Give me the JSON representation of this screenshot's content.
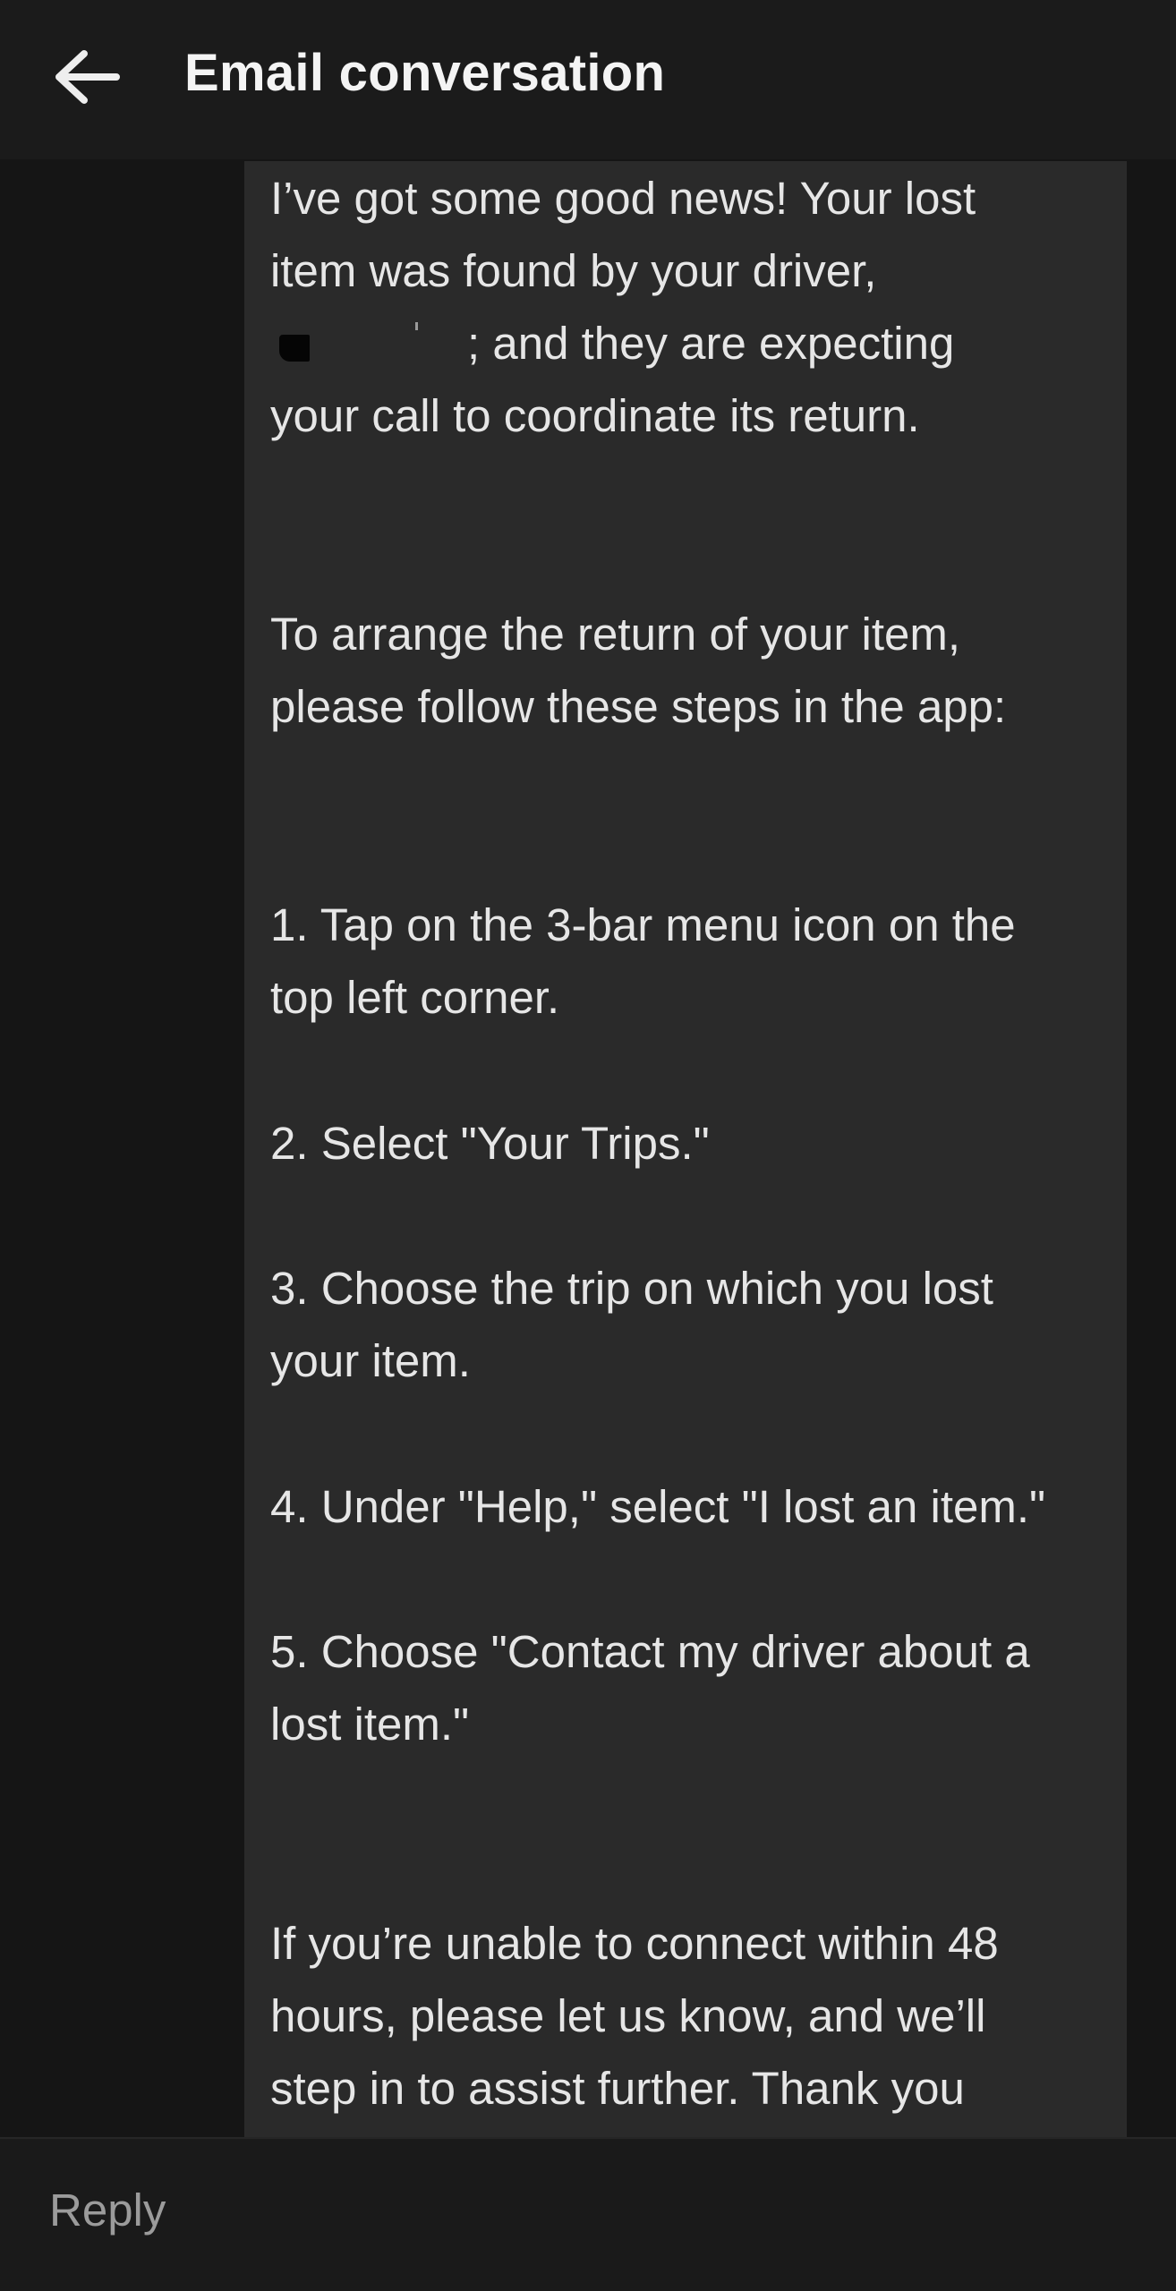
{
  "header": {
    "title": "Email conversation",
    "back_icon": "arrow-left-icon"
  },
  "message": {
    "lines": [
      "I’ve got some good news! Your lost",
      "item was found by your driver,",
      "; and they are expecting",
      "your call to coordinate its return.",
      "To arrange the return of your item,",
      "please follow these steps in the app:",
      "1. Tap on the 3-bar menu icon on the",
      "top left corner.",
      "2. Select \"Your Trips.\"",
      "3. Choose the trip on which you lost",
      "your item.",
      "4. Under \"Help,\" select \"I lost an item.\"",
      "5. Choose \"Contact my driver about a",
      "lost item.\"",
      "If you’re unable to connect within 48",
      "hours, please let us know, and we’ll",
      "step in to assist further. Thank you"
    ]
  },
  "reply": {
    "placeholder": "Reply"
  },
  "colors": {
    "background": "#151515",
    "card": "#2a2a2a",
    "text": "#e6e6e6",
    "placeholder": "#9b9b9b"
  }
}
